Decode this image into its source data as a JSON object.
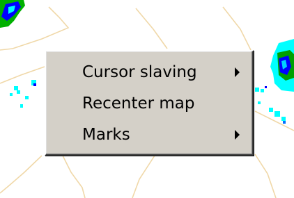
{
  "map": {
    "background_color": "#ffffff",
    "boundary_color": "#f0d8a8",
    "radar_colors": [
      "#00ffff",
      "#00c0e0",
      "#0000ff",
      "#0070ff",
      "#00a000"
    ]
  },
  "context_menu": {
    "items": [
      {
        "label": "Cursor slaving",
        "has_submenu": true,
        "submenu_icon": "chevron-right-icon"
      },
      {
        "label": "Recenter map",
        "has_submenu": false
      },
      {
        "label": "Marks",
        "has_submenu": true,
        "submenu_icon": "chevron-right-icon"
      }
    ]
  }
}
